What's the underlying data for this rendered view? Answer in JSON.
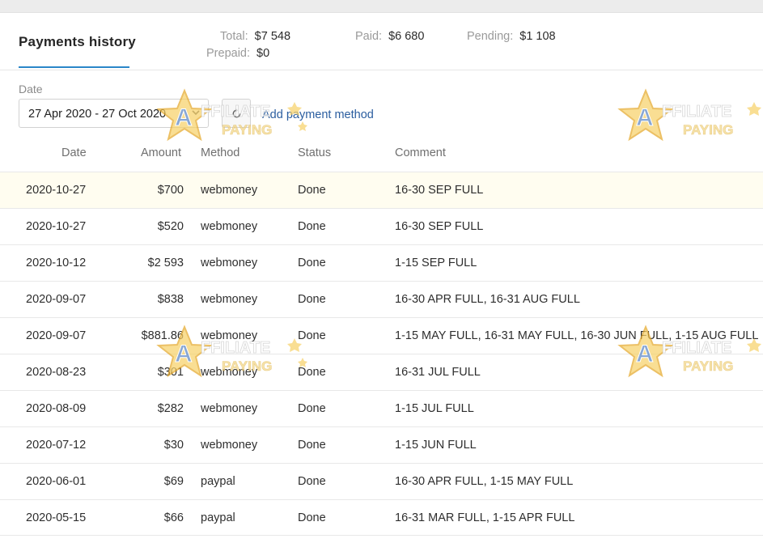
{
  "header": {
    "title": "Payments history",
    "summary": {
      "total_label": "Total:",
      "total_value": "$7 548",
      "prepaid_label": "Prepaid:",
      "prepaid_value": "$0",
      "paid_label": "Paid:",
      "paid_value": "$6 680",
      "pending_label": "Pending:",
      "pending_value": "$1 108"
    }
  },
  "filters": {
    "date_label": "Date",
    "date_range": "27 Apr 2020 - 27 Oct 2020",
    "add_method_link": "Add payment method"
  },
  "table": {
    "columns": [
      "Date",
      "Amount",
      "Method",
      "Status",
      "Comment"
    ],
    "rows": [
      {
        "date": "2020-10-27",
        "amount": "$700",
        "method": "webmoney",
        "status": "Done",
        "comment": "16-30 SEP FULL"
      },
      {
        "date": "2020-10-27",
        "amount": "$520",
        "method": "webmoney",
        "status": "Done",
        "comment": "16-30 SEP FULL"
      },
      {
        "date": "2020-10-12",
        "amount": "$2 593",
        "method": "webmoney",
        "status": "Done",
        "comment": "1-15 SEP FULL"
      },
      {
        "date": "2020-09-07",
        "amount": "$838",
        "method": "webmoney",
        "status": "Done",
        "comment": "16-30 APR FULL, 16-31 AUG FULL"
      },
      {
        "date": "2020-09-07",
        "amount": "$881.86",
        "method": "webmoney",
        "status": "Done",
        "comment": "1-15 MAY FULL, 16-31 MAY FULL, 16-30 JUN FULL, 1-15 AUG FULL"
      },
      {
        "date": "2020-08-23",
        "amount": "$301",
        "method": "webmoney",
        "status": "Done",
        "comment": "16-31 JUL FULL"
      },
      {
        "date": "2020-08-09",
        "amount": "$282",
        "method": "webmoney",
        "status": "Done",
        "comment": "1-15 JUL FULL"
      },
      {
        "date": "2020-07-12",
        "amount": "$30",
        "method": "webmoney",
        "status": "Done",
        "comment": "1-15 JUN FULL"
      },
      {
        "date": "2020-06-01",
        "amount": "$69",
        "method": "paypal",
        "status": "Done",
        "comment": "16-30 APR FULL, 1-15 MAY FULL"
      },
      {
        "date": "2020-05-15",
        "amount": "$66",
        "method": "paypal",
        "status": "Done",
        "comment": "16-31 MAR FULL, 1-15 APR FULL"
      }
    ]
  },
  "watermark": {
    "line1": "AFFILIATE",
    "line2": "PAYING",
    "icon": "star-a-logo"
  },
  "colors": {
    "accent": "#2a86c8",
    "link": "#2a5d9f",
    "highlight_row": "#fffdf0"
  }
}
